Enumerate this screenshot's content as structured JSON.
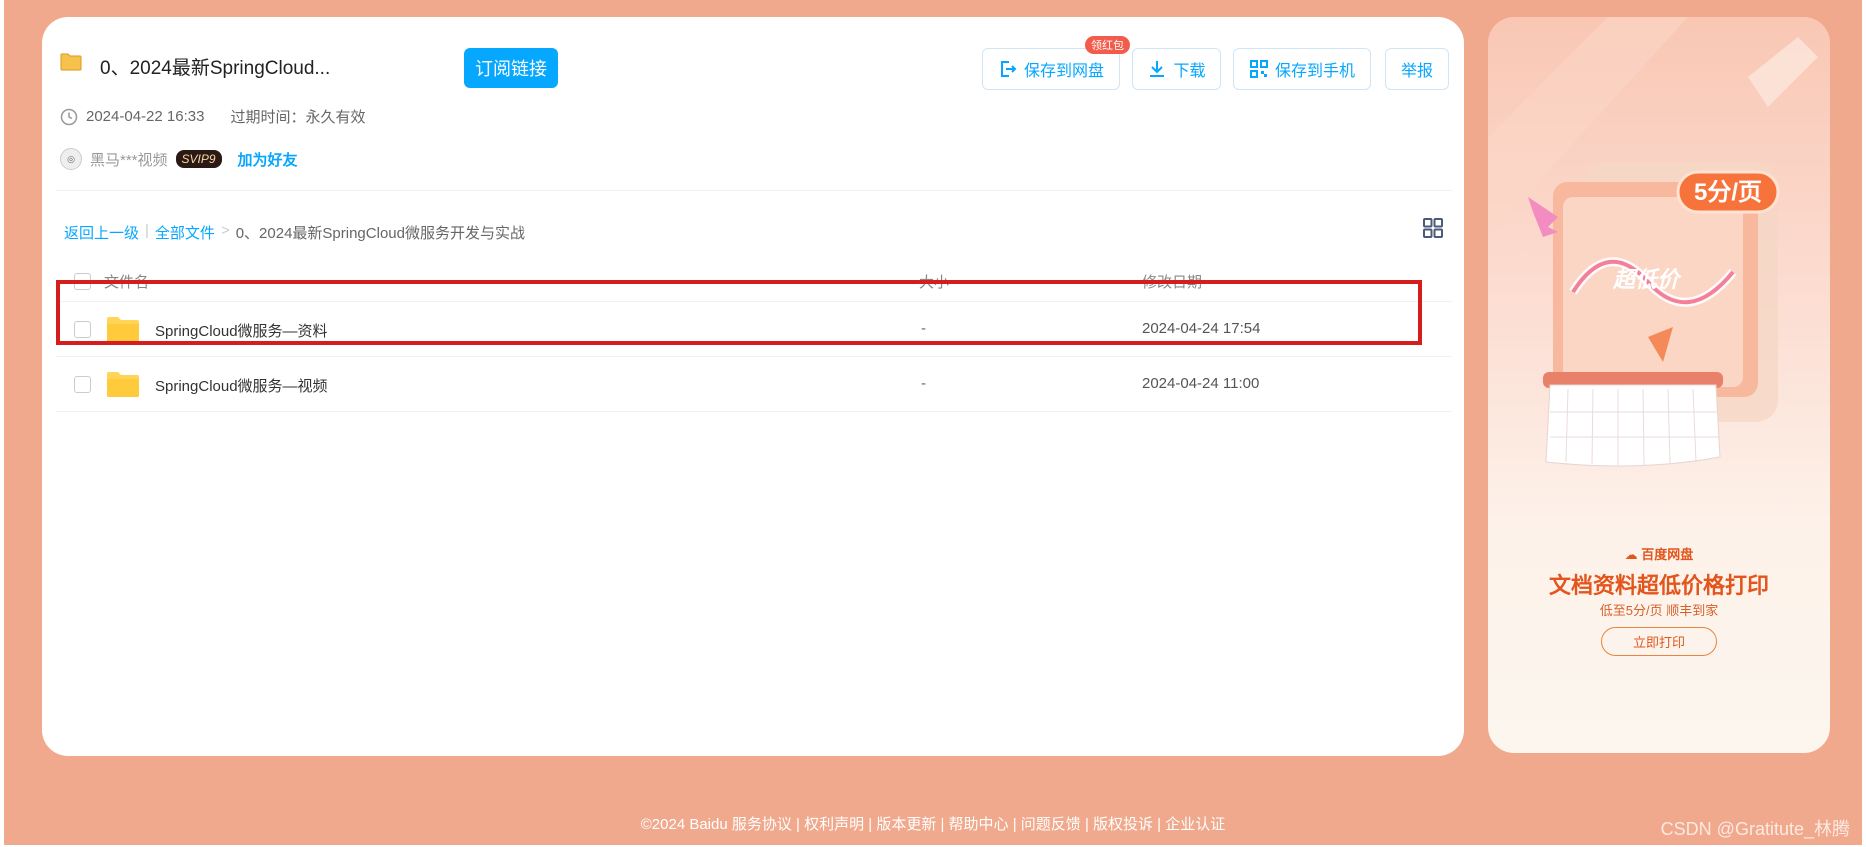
{
  "share": {
    "title": "0、2024最新SpringCloud...",
    "subscribe_label": "订阅链接",
    "created": "2024-04-22 16:33",
    "expire_label": "过期时间：永久有效",
    "user": "黑马***视频",
    "vip": "SVIP9",
    "add_friend": "加为好友"
  },
  "actions": {
    "save_netdisk": "保存到网盘",
    "redpack_badge": "领红包",
    "download": "下载",
    "save_phone": "保存到手机",
    "report": "举报"
  },
  "breadcrumb": {
    "back": "返回上一级",
    "sep1": "|",
    "all_files": "全部文件",
    "sep2": ">",
    "current": "0、2024最新SpringCloud微服务开发与实战"
  },
  "table": {
    "headers": {
      "name": "文件名",
      "size": "大小",
      "date": "修改日期"
    },
    "rows": [
      {
        "name": "SpringCloud微服务—资料",
        "size": "-",
        "date": "2024-04-24 17:54"
      },
      {
        "name": "SpringCloud微服务—视频",
        "size": "-",
        "date": "2024-04-24 11:00"
      }
    ]
  },
  "ad": {
    "price_tag": "5分/页",
    "illus_text": "超低价",
    "brand": "百度网盘",
    "title": "文档资料超低价格打印",
    "subtitle": "低至5分/页 顺丰到家",
    "button": "立即打印"
  },
  "footer": {
    "text": "©2024 Baidu  服务协议 | 权利声明 | 版本更新 | 帮助中心 | 问题反馈 | 版权投诉 | 企业认证"
  },
  "watermark": "CSDN @Gratitute_林腾",
  "colors": {
    "background": "#f0a98c",
    "accent": "#06a7ff",
    "highlight": "#d51d1d",
    "ad_orange": "#e2551d"
  }
}
